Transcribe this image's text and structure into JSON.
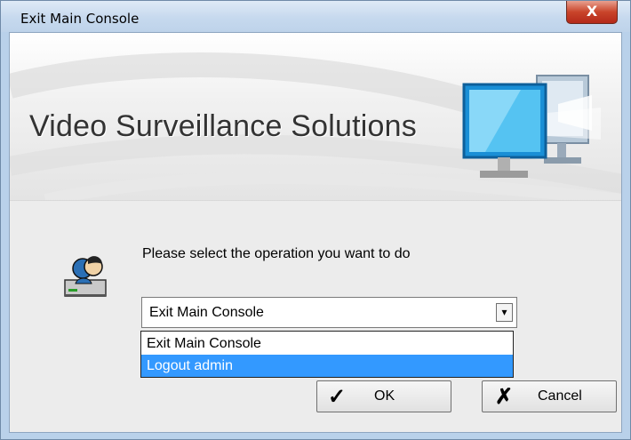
{
  "window": {
    "title": "Exit Main Console",
    "close_glyph": "X"
  },
  "banner": {
    "title": "Video Surveillance Solutions"
  },
  "prompt": "Please select the operation you want to do",
  "operation_select": {
    "value": "Exit Main Console",
    "arrow": "▾",
    "options": [
      {
        "label": "Exit Main Console",
        "selected": false
      },
      {
        "label": "Logout admin",
        "selected": true
      }
    ]
  },
  "buttons": {
    "ok": {
      "icon": "check-icon",
      "glyph": "✓",
      "label": "OK"
    },
    "cancel": {
      "icon": "x-icon",
      "glyph": "✗",
      "label": "Cancel"
    }
  },
  "colors": {
    "highlight": "#3399ff",
    "frame": "#b9d1ea",
    "close": "#c9442a"
  }
}
